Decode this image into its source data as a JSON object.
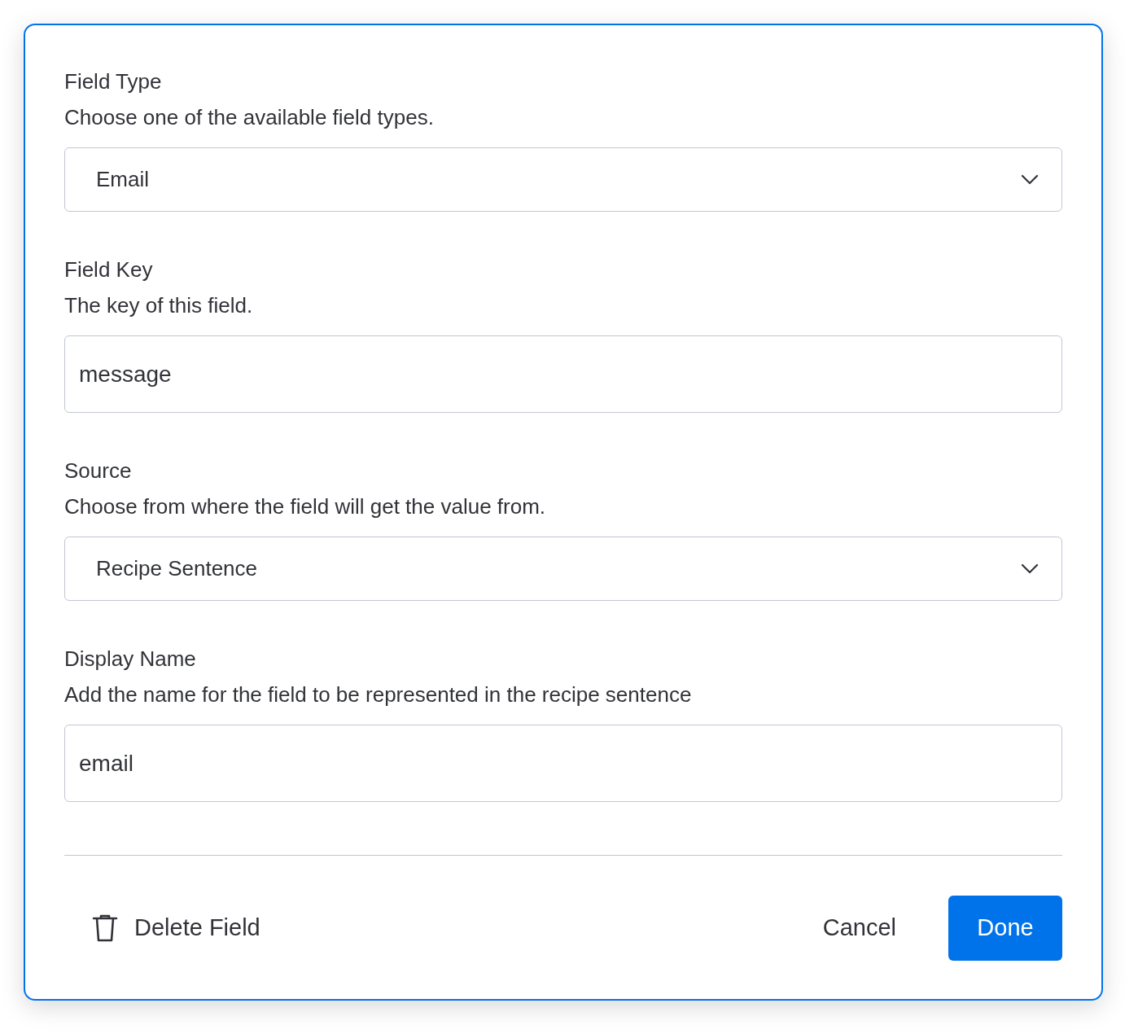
{
  "fields": [
    {
      "kind": "select",
      "label": "Field Type",
      "description": "Choose one of the available field types.",
      "value": "Email"
    },
    {
      "kind": "input",
      "label": "Field Key",
      "description": "The key of this field.",
      "value": "message"
    },
    {
      "kind": "select",
      "label": "Source",
      "description": "Choose from where the field will get the value from.",
      "value": "Recipe Sentence"
    },
    {
      "kind": "input",
      "label": "Display Name",
      "description": "Add the name for the field to be represented in the recipe sentence",
      "value": "email"
    }
  ],
  "footer": {
    "delete": "Delete Field",
    "cancel": "Cancel",
    "done": "Done"
  }
}
